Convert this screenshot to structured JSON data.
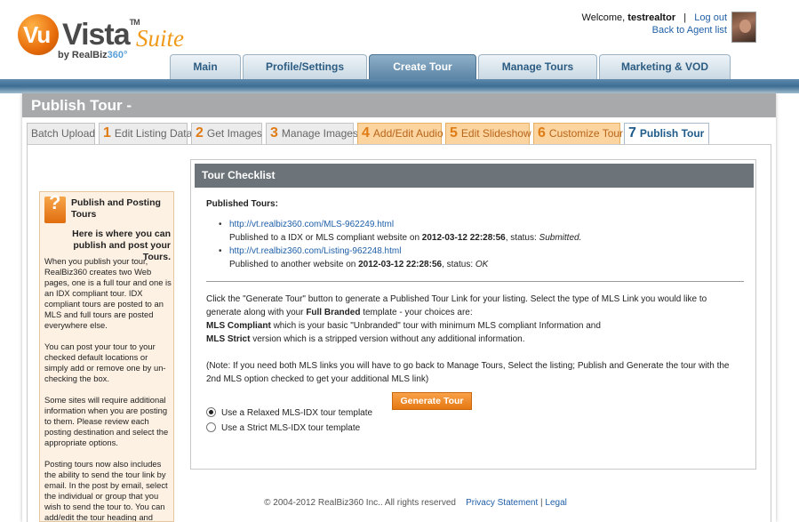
{
  "header": {
    "logo": {
      "vu": "Vu",
      "vista": "Vista",
      "tm": "TM",
      "suite": "Suite",
      "by": "by RealBiz",
      "by360": "360°"
    },
    "welcome_prefix": "Welcome,",
    "username": "testrealtor",
    "separator": "|",
    "logout": "Log out",
    "back_link": "Back to Agent list"
  },
  "nav": {
    "tabs": [
      {
        "label": "Main"
      },
      {
        "label": "Profile/Settings"
      },
      {
        "label": "Create Tour"
      },
      {
        "label": "Manage Tours"
      },
      {
        "label": "Marketing & VOD"
      }
    ],
    "active": "Create Tour"
  },
  "page": {
    "title": "Publish Tour -"
  },
  "steps": [
    {
      "num": "",
      "label": "Batch Upload"
    },
    {
      "num": "1",
      "label": "Edit Listing Data"
    },
    {
      "num": "2",
      "label": "Get Images"
    },
    {
      "num": "3",
      "label": "Manage Images"
    },
    {
      "num": "4",
      "label": "Add/Edit Audio"
    },
    {
      "num": "5",
      "label": "Edit Slideshow"
    },
    {
      "num": "6",
      "label": "Customize Tour"
    },
    {
      "num": "7",
      "label": "Publish Tour"
    }
  ],
  "help": {
    "title": "Publish and Posting Tours",
    "subtitle": "Here is where you can publish and post your Tours.",
    "paragraphs": [
      "When you publish your tour, RealBiz360 creates two Web pages, one is a full tour and one is an IDX compliant tour. IDX compliant tours are posted to an MLS and full tours are posted everywhere else.",
      "You can post your tour to your checked default locations or simply add or remove one by un-checking the box.",
      "Some sites will require additional information when you are posting to them. Please review each posting destination and select the appropriate options.",
      "Posting tours now also includes the ability to send the tour link by email. In the post by email, select the individual or group that you wish to send the tour to. You can add/edit the tour heading and"
    ]
  },
  "checklist": {
    "heading": "Tour Checklist",
    "published_label": "Published Tours:",
    "tours": [
      {
        "url": "http://vt.realbiz360.com/MLS-962249.html",
        "info_prefix": "Published to a IDX or MLS compliant website on",
        "date": "2012-03-12 22:28:56",
        "status_prefix": ", status:",
        "status": "Submitted."
      },
      {
        "url": "http://vt.realbiz360.com/Listing-962248.html",
        "info_prefix": "Published to another website on",
        "date": "2012-03-12 22:28:56",
        "status_prefix": ", status:",
        "status": "OK"
      }
    ],
    "instructions_1": "Click the \"Generate Tour\" button to generate a Published Tour Link for your listing. Select the type of MLS Link you would like to generate along with your",
    "full_branded": "Full Branded",
    "instructions_2": "template - your choices are:",
    "mls_compliant": "MLS Compliant",
    "mls_compliant_desc": "which is your basic \"Unbranded\" tour with minimum MLS compliant Information and",
    "mls_strict": "MLS Strict",
    "mls_strict_desc": "version which is a stripped version without any additional information.",
    "note": "(Note: If you need both MLS links you will have to go back to Manage Tours, Select the listing; Publish and Generate the tour with the 2nd MLS option checked to get your additional MLS link)",
    "radio_relaxed": "Use a Relaxed MLS-IDX tour template",
    "radio_strict": "Use a Strict MLS-IDX tour template",
    "selected": "relaxed",
    "generate_button": "Generate Tour"
  },
  "footer": {
    "copyright": "© 2004-2012 RealBiz360 Inc.. All rights reserved",
    "privacy": "Privacy Statement",
    "sep": "|",
    "legal": "Legal"
  }
}
